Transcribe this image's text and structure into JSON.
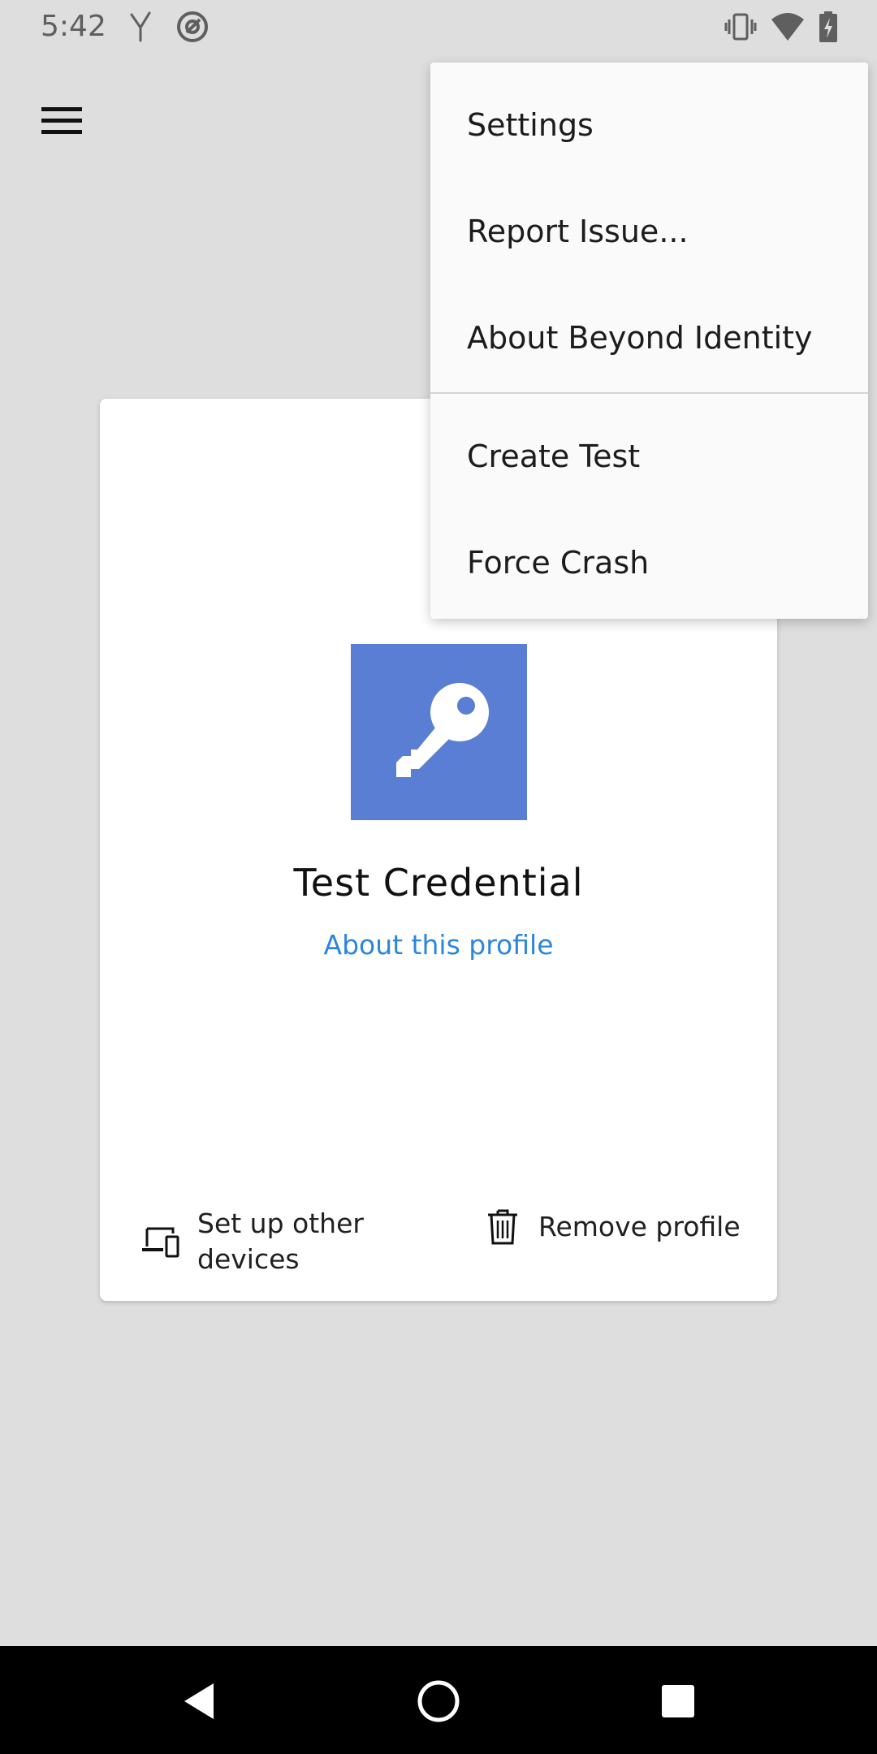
{
  "status_bar": {
    "time": "5:42",
    "icons": [
      "signal-y-icon",
      "at-sign-icon",
      "vibrate-icon",
      "wifi-icon",
      "battery-charging-icon"
    ]
  },
  "toolbar": {
    "menu_icon": "hamburger-menu-icon"
  },
  "card": {
    "title": "Test Credential",
    "link": "About this profile",
    "icon": "key-icon",
    "image_color": "#5a7ed3",
    "actions": [
      {
        "label": "Set up other devices",
        "icon": "devices-icon"
      },
      {
        "label": "Remove profile",
        "icon": "trash-icon"
      }
    ]
  },
  "overflow_menu": {
    "items": [
      {
        "label": "Settings"
      },
      {
        "label": "Report Issue..."
      },
      {
        "label": "About Beyond Identity"
      },
      {
        "label": "Create Test"
      },
      {
        "label": "Force Crash"
      }
    ]
  },
  "nav_bar": {
    "buttons": [
      "back-icon",
      "home-icon",
      "recents-icon"
    ]
  },
  "colors": {
    "background": "#dedede",
    "accent_link": "#2b86de",
    "menu_background": "#fafafa"
  }
}
